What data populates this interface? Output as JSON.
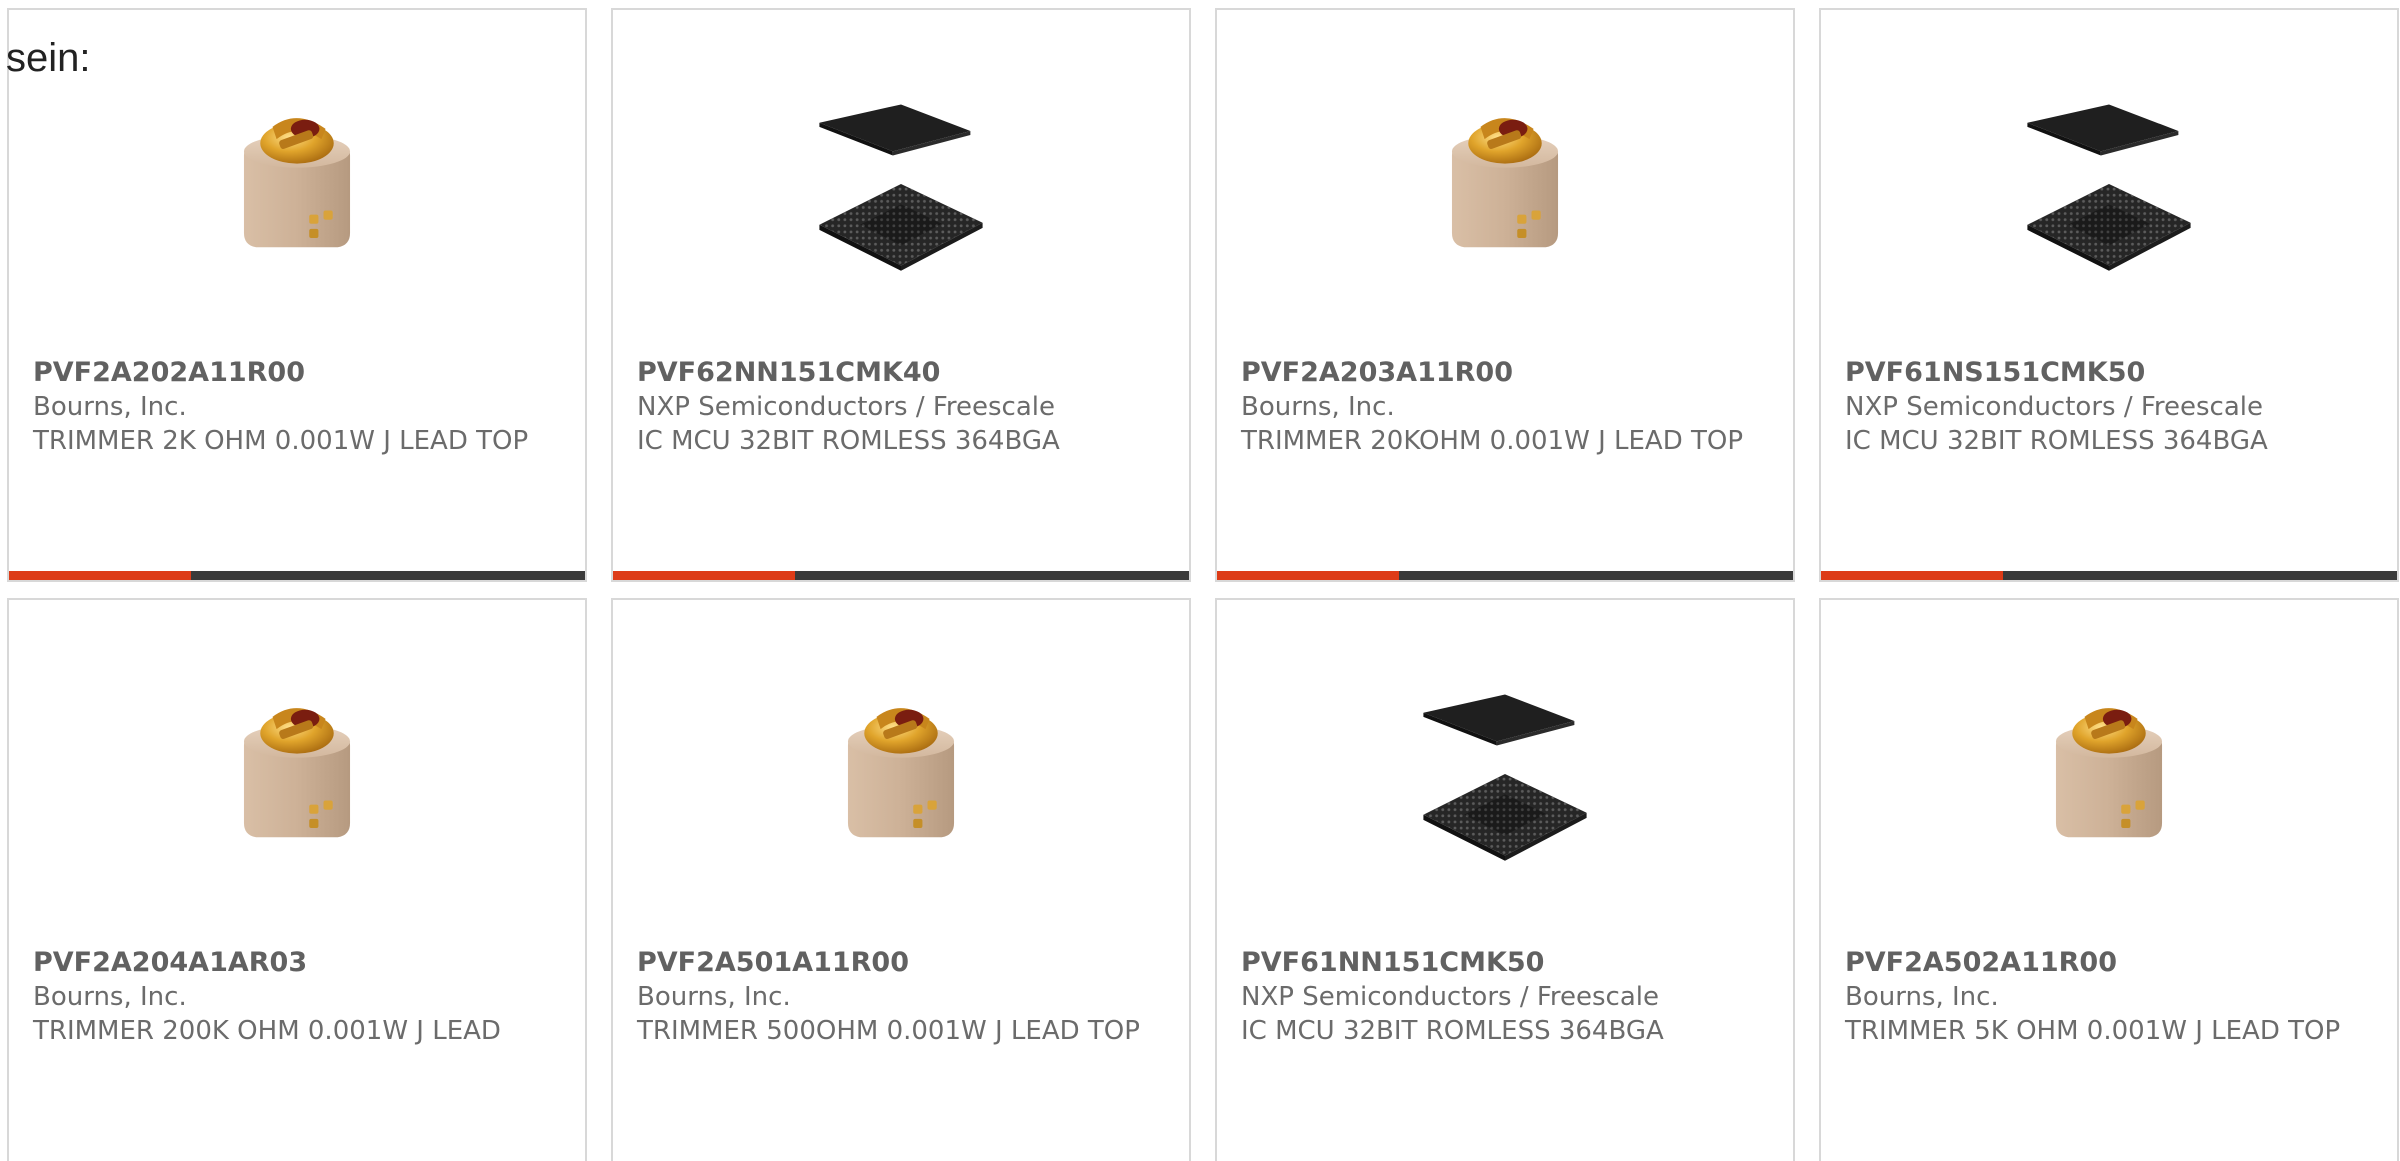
{
  "intro_text": "sein:",
  "colors": {
    "accent": "#dd3b17",
    "bar_dark": "#3a3a3a",
    "border": "#d8d8d8",
    "text": "#6b6b6b"
  },
  "products": [
    {
      "part_number": "PVF2A202A11R00",
      "manufacturer": "Bourns, Inc.",
      "description": "TRIMMER 2K OHM 0.001W J LEAD TOP",
      "image": "trimmer-potentiometer-icon"
    },
    {
      "part_number": "PVF62NN151CMK40",
      "manufacturer": "NXP Semiconductors / Freescale",
      "description": "IC MCU 32BIT ROMLESS 364BGA",
      "image": "bga-chip-icon"
    },
    {
      "part_number": "PVF2A203A11R00",
      "manufacturer": "Bourns, Inc.",
      "description": "TRIMMER 20KOHM 0.001W J LEAD TOP",
      "image": "trimmer-potentiometer-icon"
    },
    {
      "part_number": "PVF61NS151CMK50",
      "manufacturer": "NXP Semiconductors / Freescale",
      "description": "IC MCU 32BIT ROMLESS 364BGA",
      "image": "bga-chip-icon"
    },
    {
      "part_number": "PVF2A204A1AR03",
      "manufacturer": "Bourns, Inc.",
      "description": "TRIMMER 200K OHM 0.001W J LEAD",
      "image": "trimmer-potentiometer-icon"
    },
    {
      "part_number": "PVF2A501A11R00",
      "manufacturer": "Bourns, Inc.",
      "description": "TRIMMER 500OHM 0.001W J LEAD TOP",
      "image": "trimmer-potentiometer-icon"
    },
    {
      "part_number": "PVF61NN151CMK50",
      "manufacturer": "NXP Semiconductors / Freescale",
      "description": "IC MCU 32BIT ROMLESS 364BGA",
      "image": "bga-chip-icon"
    },
    {
      "part_number": "PVF2A502A11R00",
      "manufacturer": "Bourns, Inc.",
      "description": "TRIMMER 5K OHM 0.001W J LEAD TOP",
      "image": "trimmer-potentiometer-icon"
    }
  ]
}
